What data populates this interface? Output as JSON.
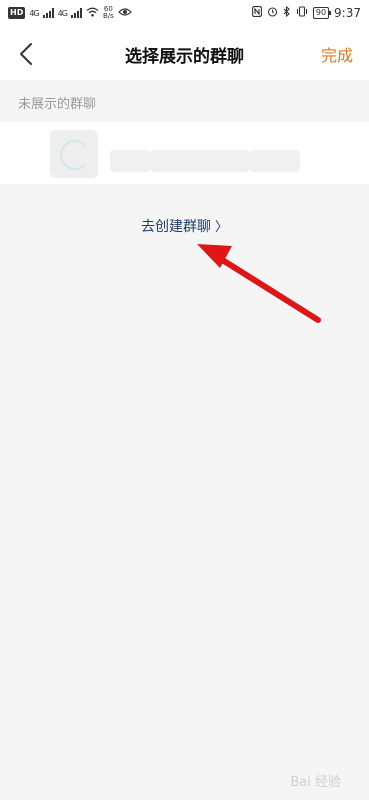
{
  "status_bar": {
    "hd": "HD",
    "sig1": "4G",
    "sig2": "4G",
    "speed_value": "60",
    "speed_unit": "B/s",
    "battery": "90",
    "time": "9:37"
  },
  "header": {
    "title": "选择展示的群聊",
    "done_label": "完成"
  },
  "section": {
    "label": "未展示的群聊"
  },
  "create_link": {
    "label": "去创建群聊",
    "chevron": "〉"
  },
  "colors": {
    "accent": "#e07a1f",
    "link": "#1f3b62",
    "annotation_arrow": "#e01515"
  },
  "watermark": "Bai 经验"
}
